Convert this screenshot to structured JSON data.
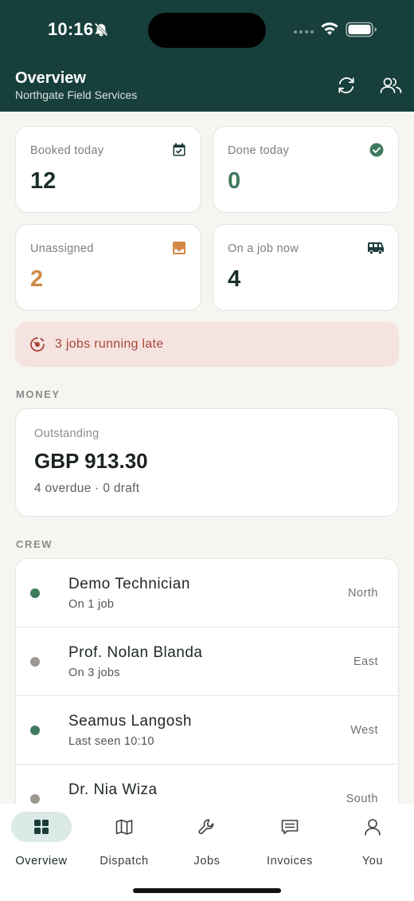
{
  "status_bar": {
    "time": "10:16"
  },
  "header": {
    "title": "Overview",
    "subtitle": "Northgate Field Services",
    "refresh_icon": "refresh-icon",
    "team_icon": "people-icon"
  },
  "stats": [
    {
      "label": "Booked today",
      "value": "12",
      "icon": "calendar-check-icon",
      "color": "#1b2f2c"
    },
    {
      "label": "Done today",
      "value": "0",
      "icon": "check-circle-icon",
      "color": "#3f7a5e"
    },
    {
      "label": "Unassigned",
      "value": "2",
      "icon": "inbox-icon",
      "color": "#d08a46"
    },
    {
      "label": "On a job now",
      "value": "4",
      "icon": "van-icon",
      "color": "#1b2f2c"
    }
  ],
  "alert": {
    "text": "3 jobs running late",
    "icon": "clock-alert-icon",
    "color": "#a8453a"
  },
  "money": {
    "section_label": "MONEY",
    "outstanding_label": "Outstanding",
    "outstanding_value": "GBP 913.30",
    "summary": "4 overdue · 0 draft"
  },
  "crew": {
    "section_label": "CREW",
    "members": [
      {
        "name": "Demo Technician",
        "status": "On 1 job",
        "region": "North",
        "dot_color": "#3f7a5e"
      },
      {
        "name": "Prof. Nolan Blanda",
        "status": "On 3 jobs",
        "region": "East",
        "dot_color": "#9c9890"
      },
      {
        "name": "Seamus Langosh",
        "status": "Last seen 10:10",
        "region": "West",
        "dot_color": "#3f7a5e"
      },
      {
        "name": "Dr. Nia Wiza",
        "status": "",
        "region": "South",
        "dot_color": "#9c9890"
      }
    ]
  },
  "tabs": [
    {
      "label": "Overview",
      "icon": "grid-icon",
      "active": true
    },
    {
      "label": "Dispatch",
      "icon": "map-icon",
      "active": false
    },
    {
      "label": "Jobs",
      "icon": "wrench-icon",
      "active": false
    },
    {
      "label": "Invoices",
      "icon": "receipt-icon",
      "active": false
    },
    {
      "label": "You",
      "icon": "person-icon",
      "active": false
    }
  ],
  "colors": {
    "header_bg": "#173f3b",
    "accent": "#3f7a5e",
    "page_bg": "#f6f5f2"
  }
}
